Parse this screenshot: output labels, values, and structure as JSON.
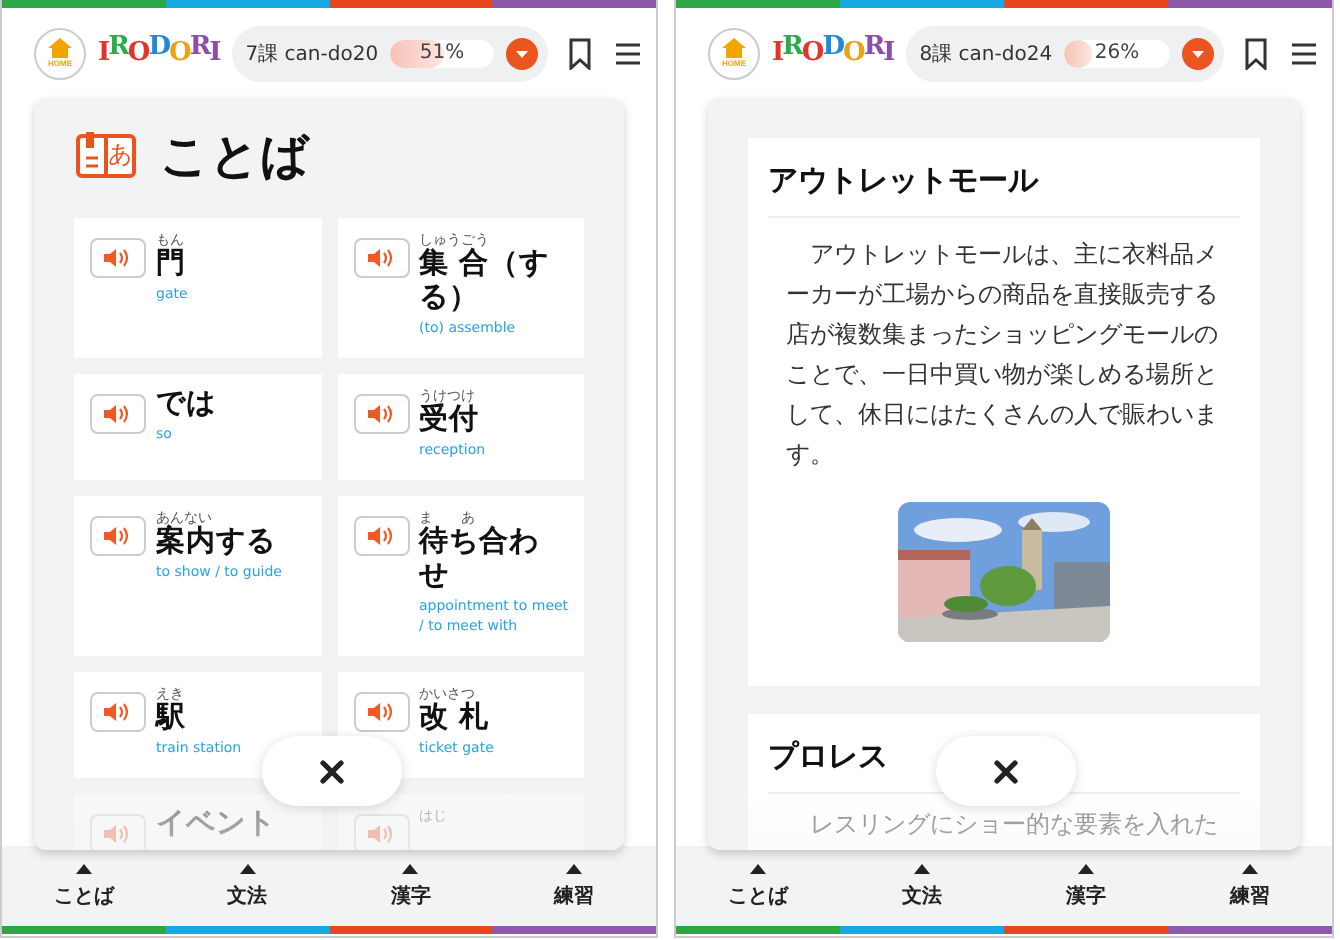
{
  "panels": [
    {
      "header": {
        "home_label": "HOME",
        "logo": "IRODORI",
        "lesson": "7課 can-do20",
        "progress": {
          "level": 0.51,
          "reading": "51%"
        }
      },
      "nav": [
        "ことば",
        "文法",
        "漢字",
        "練習"
      ],
      "content": {
        "kind": "vocabulary",
        "title": "ことば",
        "icon_label": "あ",
        "words": [
          {
            "reading": "もん",
            "word": "門",
            "meaning": "gate",
            "faded": false
          },
          {
            "reading": "しゅうごう",
            "word": "集 合（する）",
            "meaning": "(to) assemble",
            "faded": false
          },
          {
            "word": "では",
            "meaning": "so",
            "faded": false
          },
          {
            "reading": "うけつけ",
            "word": "受付",
            "meaning": "reception",
            "faded": false
          },
          {
            "reading": "あんない",
            "word": "案内する",
            "meaning": "to show / to guide",
            "faded": false
          },
          {
            "reading": "ま　　あ",
            "word": "待ち合わせ",
            "meaning": "appointment to meet / to meet with",
            "faded": false
          },
          {
            "reading": "えき",
            "word": "駅",
            "meaning": "train station",
            "faded": false
          },
          {
            "reading": "かいさつ",
            "word": "改 札",
            "meaning": "ticket gate",
            "faded": false
          },
          {
            "word": "イベント",
            "faded": true
          },
          {
            "reading": "はじ",
            "faded": true
          }
        ]
      }
    },
    {
      "header": {
        "home_label": "HOME",
        "logo": "IRODORI",
        "lesson": "8課 can-do24",
        "progress": {
          "level": 0.26,
          "reading": "26%"
        }
      },
      "nav": [
        "ことば",
        "文法",
        "漢字",
        "練習"
      ],
      "content": {
        "kind": "articles",
        "articles": [
          {
            "title": "アウトレットモール",
            "text": "アウトレットモールは、主に衣料品メーカーが工場からの商品を直接販売する店が複数集まったショッピングモールのことで、一日中買い物が楽しめる場所として、休日にはたくさんの人で賑わいます。",
            "faded": false
          },
          {
            "title": "プロレス",
            "text": "レスリングにショー的な要素を入れた",
            "faded": true
          }
        ]
      }
    }
  ]
}
